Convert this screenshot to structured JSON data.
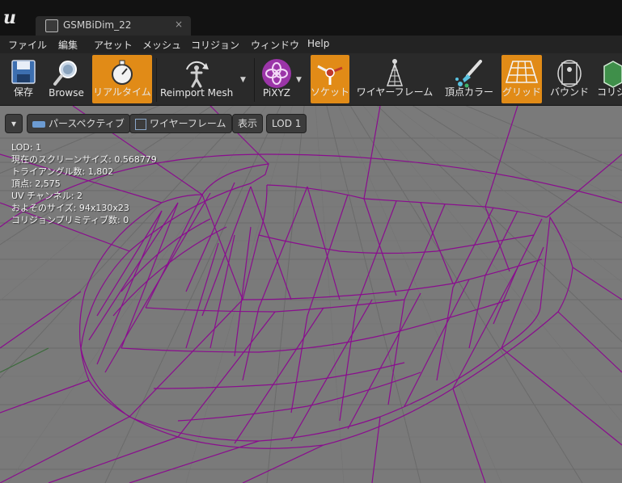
{
  "window": {
    "tab_title": "GSMBiDim_22",
    "tab_close": "×"
  },
  "menu": [
    "ファイル",
    "編集",
    "アセット",
    "メッシュ",
    "コリジョン",
    "ウィンドウ",
    "Help"
  ],
  "toolbar": {
    "save": "保存",
    "browse": "Browse",
    "realtime": "リアルタイム",
    "reimport": "Reimport Mesh",
    "pixyz": "PiXYZ",
    "socket": "ソケット",
    "wireframe": "ワイヤーフレーム",
    "vertex_color": "頂点カラー",
    "grid": "グリッド",
    "bounds": "バウンド",
    "collision": "コリジ"
  },
  "viewport": {
    "perspective": "パースペクティブ",
    "wireframe_mode": "ワイヤーフレーム",
    "show": "表示",
    "lod": "LOD 1",
    "stats": [
      "LOD: 1",
      "現在のスクリーンサイズ: 0.568779",
      "トライアングル数: 1,802",
      "頂点: 2,575",
      "UV チャンネル: 2",
      "およそのサイズ: 94x130x23",
      "コリジョンプリミティブ数: 0"
    ]
  },
  "colors": {
    "accent": "#e18b17",
    "wire": "#8a0d8e"
  }
}
